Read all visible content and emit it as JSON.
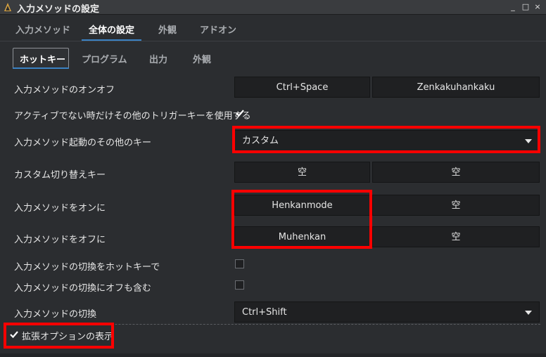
{
  "window": {
    "title": "入力メソッドの設定",
    "controls": {
      "minimize": "_",
      "maximize": "□",
      "close": "×"
    }
  },
  "top_tabs": [
    {
      "label": "入力メソッド"
    },
    {
      "label": "全体の設定"
    },
    {
      "label": "外観"
    },
    {
      "label": "アドオン"
    }
  ],
  "inner_tabs": [
    {
      "label": "ホットキー"
    },
    {
      "label": "プログラム"
    },
    {
      "label": "出力"
    },
    {
      "label": "外観"
    }
  ],
  "hotkeys": {
    "toggle_im": {
      "label": "入力メソッドのオンオフ",
      "key1": "Ctrl+Space",
      "key2": "Zenkakuhankaku"
    },
    "trigger_only_inactive": {
      "label": "アクティブでない時だけその他のトリガーキーを使用する",
      "checked": true
    },
    "other_activate_keys": {
      "label": "入力メソッド起動のその他のキー",
      "value": "カスタム"
    },
    "custom_switch": {
      "label": "カスタム切り替えキー",
      "key1": "空",
      "key2": "空"
    },
    "im_on": {
      "label": "入力メソッドをオンに",
      "key1": "Henkanmode",
      "key2": "空"
    },
    "im_off": {
      "label": "入力メソッドをオフに",
      "key1": "Muhenkan",
      "key2": "空"
    },
    "switch_by_hotkey": {
      "label": "入力メソッドの切換をホットキーで",
      "checked": false
    },
    "switch_include_off": {
      "label": "入力メソッドの切換にオフも含む",
      "checked": false
    },
    "im_switch": {
      "label": "入力メソッドの切換",
      "value": "Ctrl+Shift"
    }
  },
  "advanced": {
    "label": "拡張オプションの表示",
    "checked": true
  },
  "highlight_color": "#ff0000",
  "accent_color": "#3b82c4"
}
